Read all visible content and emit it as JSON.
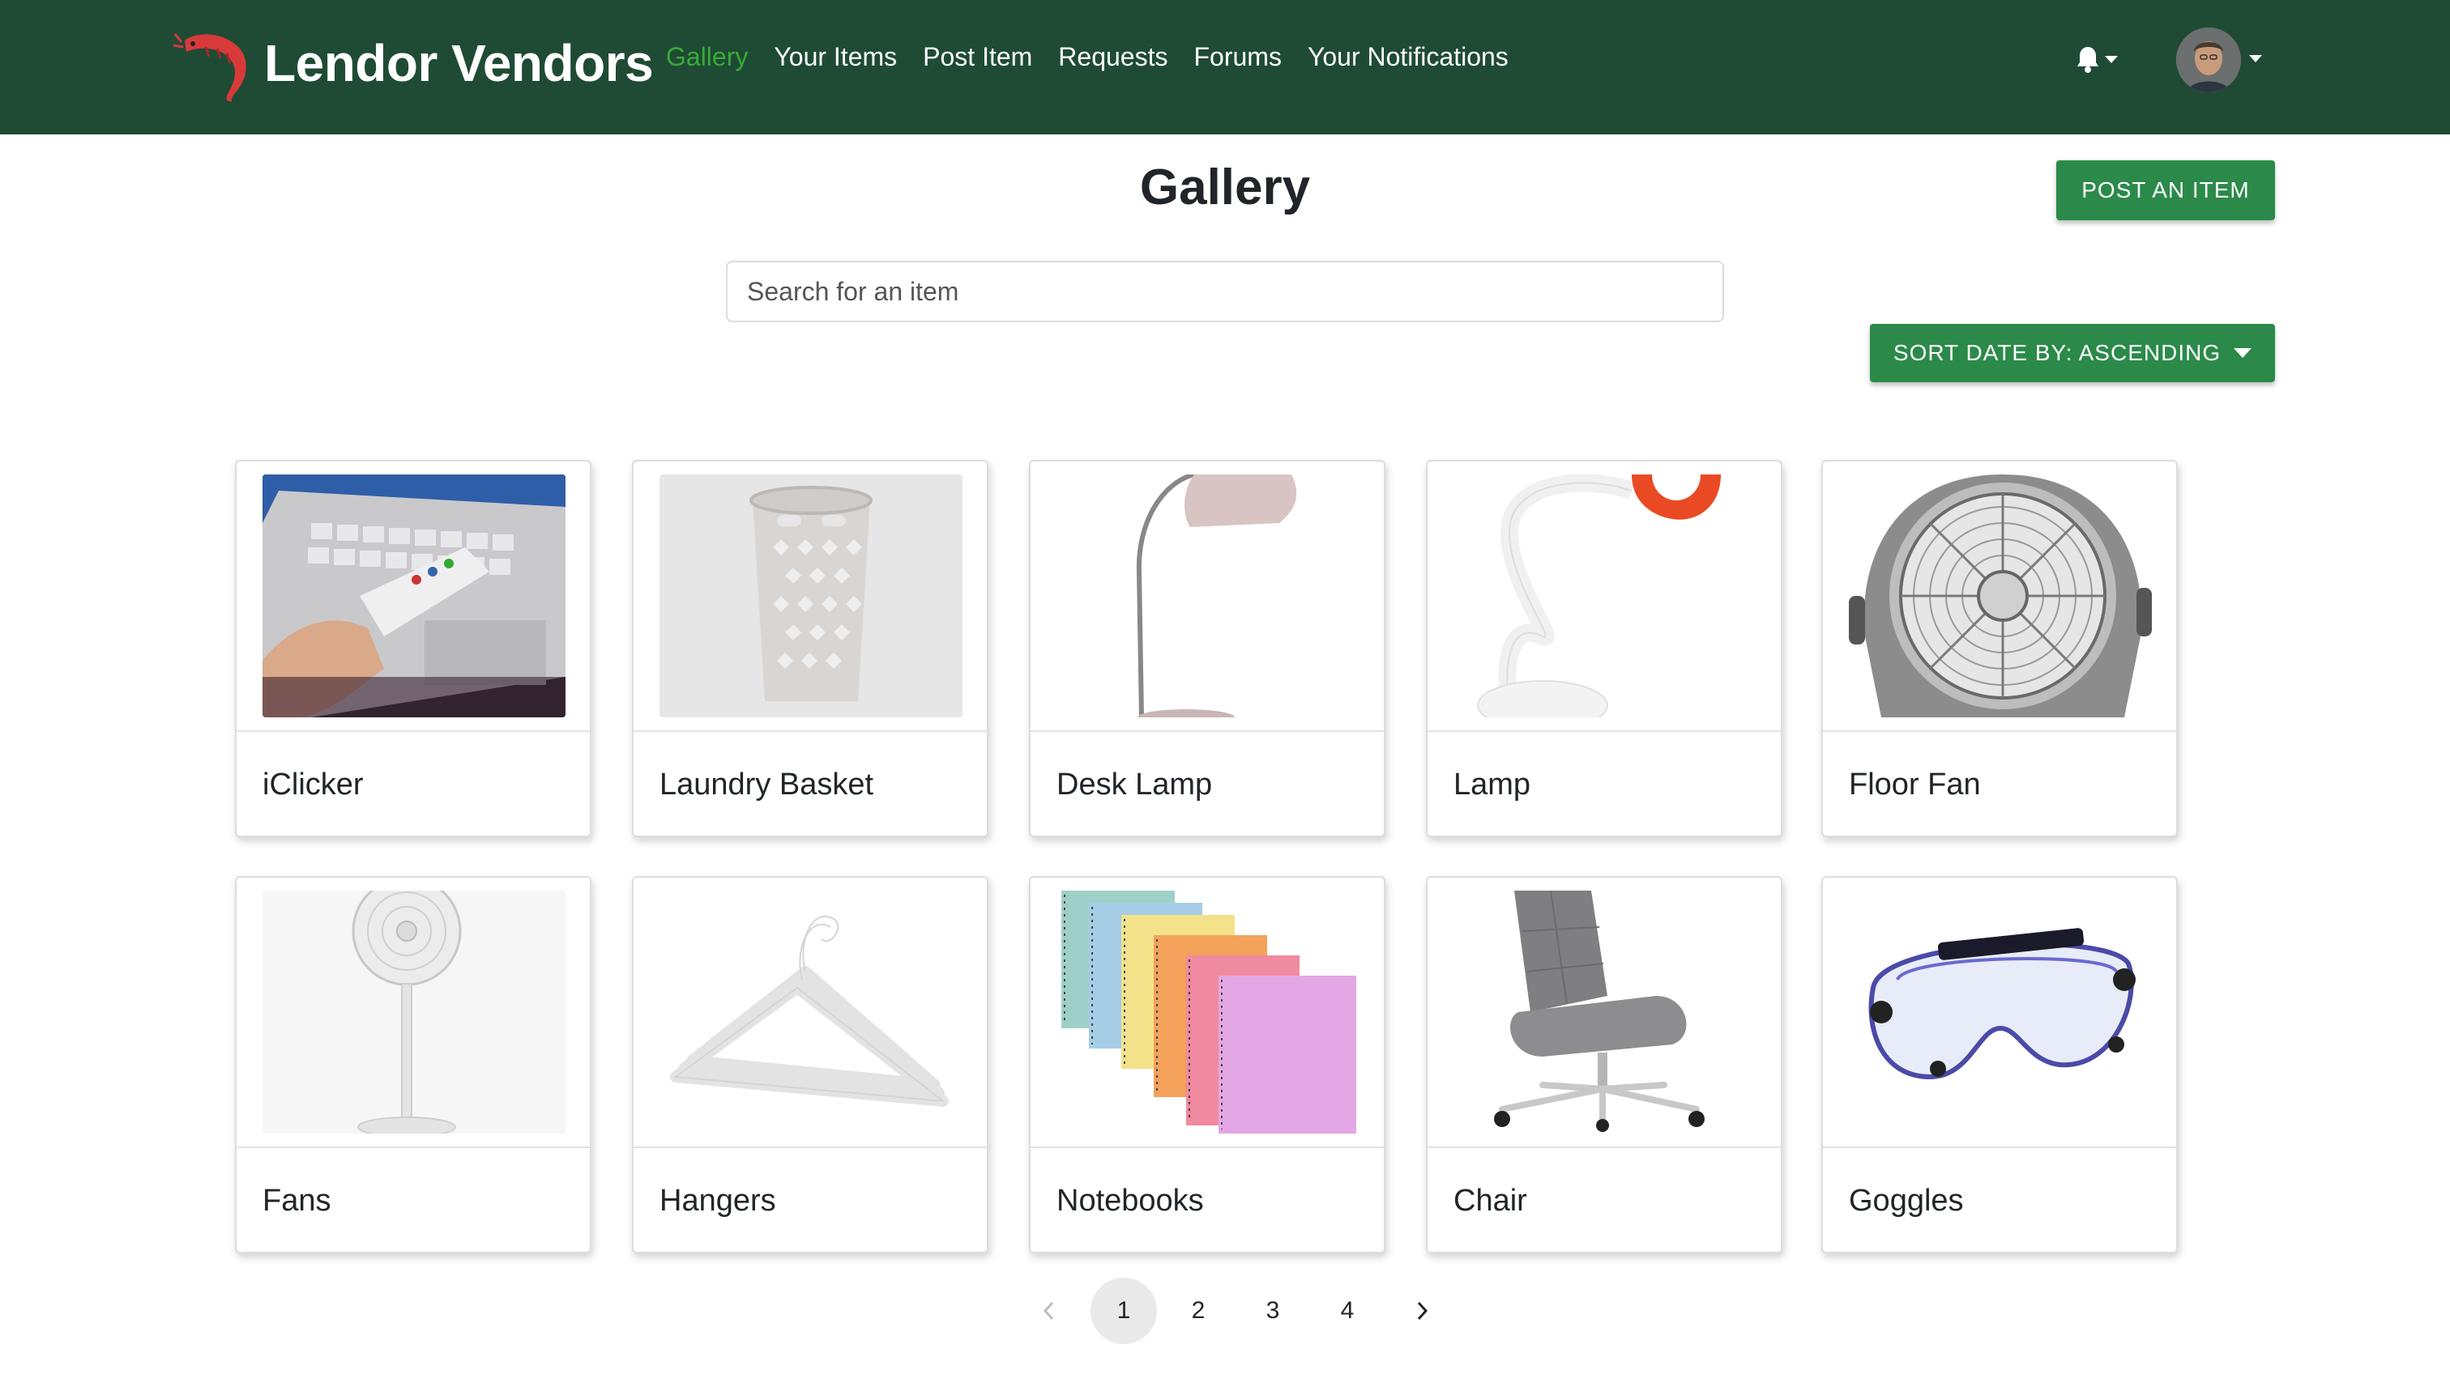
{
  "nav": {
    "brand": "Lendor Vendors",
    "links": [
      {
        "label": "Gallery",
        "active": true
      },
      {
        "label": "Your Items"
      },
      {
        "label": "Post Item"
      },
      {
        "label": "Requests"
      },
      {
        "label": "Forums"
      },
      {
        "label": "Your Notifications"
      }
    ],
    "icons": {
      "logo": "shrimp-logo-icon",
      "notifications": "bell-icon",
      "avatar": "user-avatar"
    }
  },
  "page": {
    "title": "Gallery",
    "post_button": "POST AN ITEM",
    "search_placeholder": "Search for an item",
    "sort_button": "SORT DATE BY: ASCENDING"
  },
  "items": [
    {
      "title": "iClicker"
    },
    {
      "title": "Laundry Basket"
    },
    {
      "title": "Desk Lamp"
    },
    {
      "title": "Lamp"
    },
    {
      "title": "Floor Fan"
    },
    {
      "title": "Fans"
    },
    {
      "title": "Hangers"
    },
    {
      "title": "Notebooks"
    },
    {
      "title": "Chair"
    },
    {
      "title": "Goggles"
    }
  ],
  "pagination": {
    "pages": [
      "1",
      "2",
      "3",
      "4"
    ],
    "current": "1"
  },
  "colors": {
    "navbar": "#1f4b35",
    "accent_green": "#2b8a4a",
    "active_link": "#3aaa35"
  }
}
